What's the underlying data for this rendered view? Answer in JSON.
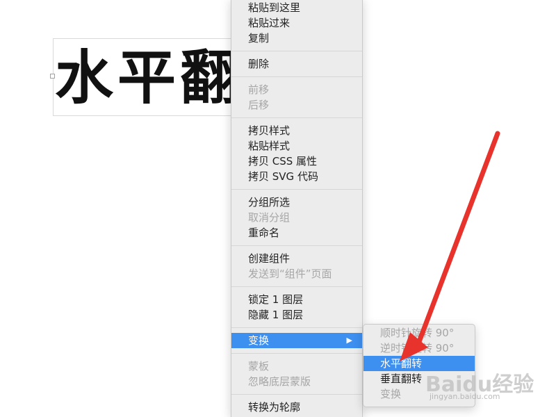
{
  "canvas": {
    "text": "水平翻转"
  },
  "context_menu": {
    "groups": [
      [
        {
          "label": "粘贴到这里",
          "enabled": true
        },
        {
          "label": "粘贴过来",
          "enabled": true
        },
        {
          "label": "复制",
          "enabled": true
        }
      ],
      [
        {
          "label": "删除",
          "enabled": true
        }
      ],
      [
        {
          "label": "前移",
          "enabled": false
        },
        {
          "label": "后移",
          "enabled": false
        }
      ],
      [
        {
          "label": "拷贝样式",
          "enabled": true
        },
        {
          "label": "粘贴样式",
          "enabled": true
        },
        {
          "label": "拷贝 CSS 属性",
          "enabled": true
        },
        {
          "label": "拷贝 SVG 代码",
          "enabled": true
        }
      ],
      [
        {
          "label": "分组所选",
          "enabled": true
        },
        {
          "label": "取消分组",
          "enabled": false
        },
        {
          "label": "重命名",
          "enabled": true
        }
      ],
      [
        {
          "label": "创建组件",
          "enabled": true
        },
        {
          "label": "发送到“组件”页面",
          "enabled": false
        }
      ],
      [
        {
          "label": "锁定 1 图层",
          "enabled": true
        },
        {
          "label": "隐藏 1 图层",
          "enabled": true
        }
      ],
      [
        {
          "label": "变换",
          "enabled": true,
          "active": true,
          "arrow": "▶"
        }
      ],
      [
        {
          "label": "蒙板",
          "enabled": false
        },
        {
          "label": "忽略底层蒙版",
          "enabled": false
        }
      ],
      [
        {
          "label": "转换为轮廓",
          "enabled": true
        }
      ]
    ]
  },
  "submenu": {
    "items": [
      {
        "label": "顺时针旋转 90°",
        "enabled": false
      },
      {
        "label": "逆时针旋转 90°",
        "enabled": false
      },
      {
        "label": "水平翻转",
        "enabled": true,
        "active": true
      },
      {
        "label": "垂直翻转",
        "enabled": true
      },
      {
        "label": "变换",
        "enabled": false
      }
    ]
  },
  "watermark": {
    "logo": "Baidu经验",
    "url": "jingyan.baidu.com"
  },
  "colors": {
    "menu_bg": "#ececec",
    "highlight": "#3d8ff0",
    "disabled_text": "#a6a6a6",
    "annotation_arrow": "#e8322c"
  },
  "icons": {
    "submenu_arrow": "triangle-right-icon",
    "annotation": "red-arrow-icon"
  }
}
